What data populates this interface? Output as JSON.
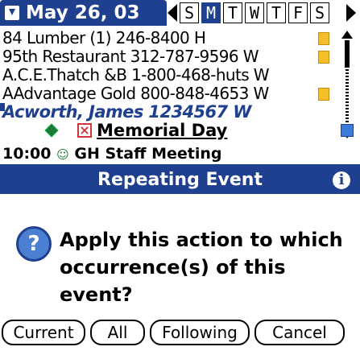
{
  "header": {
    "date": "May 26, 03",
    "days": [
      "S",
      "M",
      "T",
      "W",
      "T",
      "F",
      "S"
    ],
    "selected_day_index": 1
  },
  "contacts": [
    {
      "text": "84 Lumber          (1) 246-8400 H",
      "note": true
    },
    {
      "text": "95th Restaurant 312-787-9596 W",
      "note": true
    },
    {
      "text": "A.C.E.Thatch &B 1-800-468-huts W",
      "note": false
    },
    {
      "text": "AAdvantage Gold 800-848-4653 W",
      "note": true
    },
    {
      "text": "Acworth, James  1234567 W",
      "note": false,
      "highlight": true
    }
  ],
  "events": {
    "holiday": "Memorial Day",
    "meeting_time": "10:00",
    "meeting_title": "GH Staff Meeting"
  },
  "dialog": {
    "title": "Repeating Event",
    "message": "Apply this action to which occurrence(s) of this event?",
    "buttons": [
      "Current",
      "All",
      "Following",
      "Cancel"
    ]
  },
  "colors": {
    "accent": "#1f3f8f",
    "note": "#f3c02a",
    "question_icon": "#4b7fd1"
  }
}
